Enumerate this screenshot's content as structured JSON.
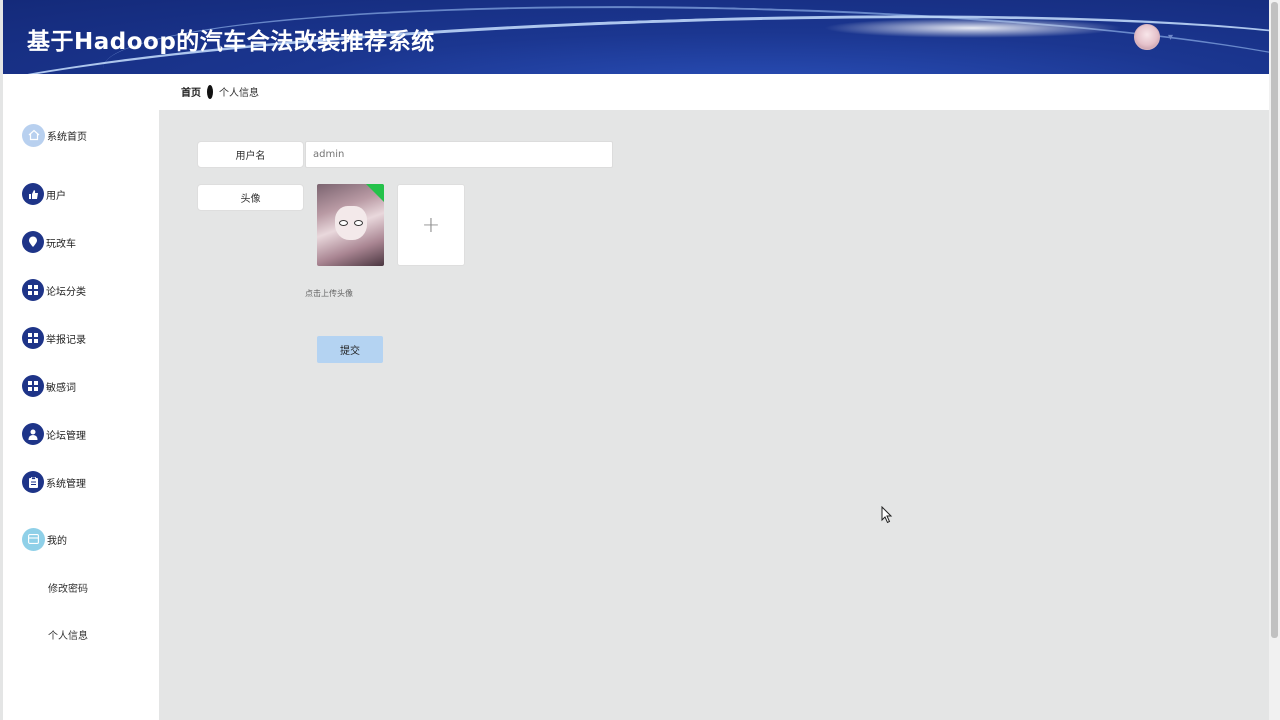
{
  "header": {
    "title": "基于Hadoop的汽车合法改装推荐系统",
    "avatar_icon": "user-avatar",
    "caret": "▾"
  },
  "breadcrumb": {
    "home": "首页",
    "current": "个人信息"
  },
  "sidebar": {
    "items": [
      {
        "label": "系统首页",
        "icon": "home-icon"
      },
      {
        "label": "用户",
        "icon": "thumb-icon"
      },
      {
        "label": "玩改车",
        "icon": "location-icon"
      },
      {
        "label": "论坛分类",
        "icon": "grid-icon"
      },
      {
        "label": "举报记录",
        "icon": "grid-icon"
      },
      {
        "label": "敏感词",
        "icon": "grid-icon"
      },
      {
        "label": "论坛管理",
        "icon": "person-icon"
      },
      {
        "label": "系统管理",
        "icon": "clipboard-icon"
      },
      {
        "label": "我的",
        "icon": "card-icon"
      }
    ],
    "submenu": [
      {
        "label": "修改密码"
      },
      {
        "label": "个人信息"
      }
    ]
  },
  "form": {
    "username_label": "用户名",
    "username_placeholder": "admin",
    "avatar_label": "头像",
    "upload_hint": "点击上传头像",
    "upload_plus": "+",
    "submit_label": "提交"
  }
}
